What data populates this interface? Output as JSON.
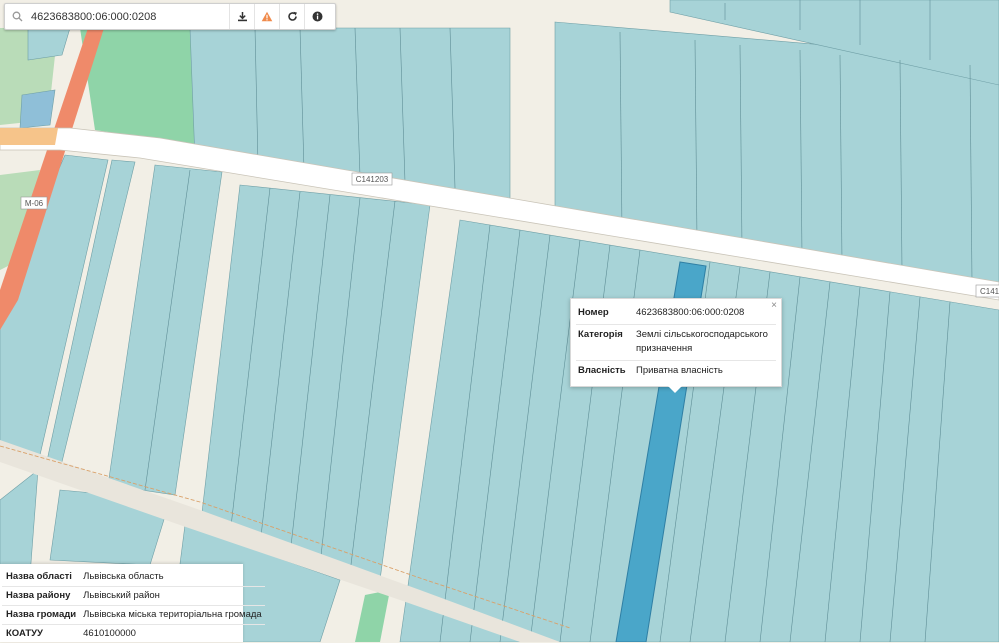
{
  "search": {
    "value": "4623683800:06:000:0208"
  },
  "toolbar": {
    "icons": [
      "download-icon",
      "warning-icon",
      "refresh-icon",
      "info-icon"
    ],
    "warning_color": "#f08a4b"
  },
  "map": {
    "road_labels": {
      "m06": "М-06",
      "c141203": "С141203",
      "c141_right": "С141"
    },
    "colors": {
      "parcel_fill": "#a7d3d7",
      "parcel_selected": "#4aa6c9",
      "road_highway": "#ef8a6a",
      "land_green": "#8fd4a8",
      "background": "#f2efe6"
    }
  },
  "popup": {
    "close": "×",
    "rows": [
      {
        "key": "Номер",
        "value": "4623683800:06:000:0208"
      },
      {
        "key": "Категорія",
        "value": "Землі сільськогосподарського призначення"
      },
      {
        "key": "Власність",
        "value": "Приватна власність"
      }
    ]
  },
  "info": {
    "rows": [
      {
        "key": "Назва області",
        "value": "Львівська область"
      },
      {
        "key": "Назва району",
        "value": "Львівський район"
      },
      {
        "key": "Назва громади",
        "value": "Львівська міська територіальна громада"
      },
      {
        "key": "КОАТУУ",
        "value": "4610100000"
      }
    ]
  }
}
